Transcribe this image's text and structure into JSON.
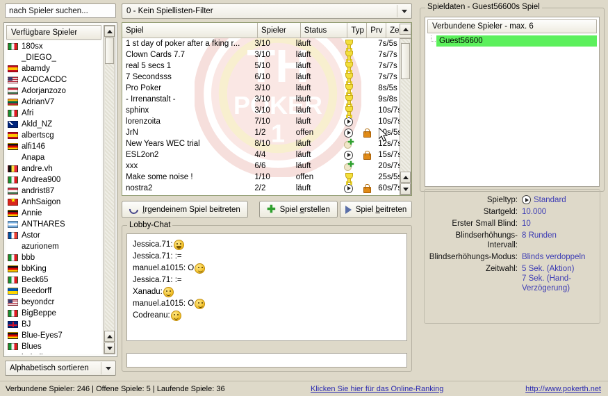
{
  "search": {
    "placeholder": "nach Spieler suchen...",
    "value": "nach Spieler suchen..."
  },
  "filter": {
    "selected": "0 - Kein Spiellisten-Filter"
  },
  "sort": {
    "selected": "Alphabetisch sortieren"
  },
  "players": {
    "header": "Verfügbare Spieler",
    "items": [
      {
        "name": "180sx",
        "flag": "it"
      },
      {
        "name": "_DIEGO_",
        "flag": ""
      },
      {
        "name": "abamdy",
        "flag": "es"
      },
      {
        "name": "ACDCACDC",
        "flag": "us"
      },
      {
        "name": "Adorjanzozo",
        "flag": "hu"
      },
      {
        "name": "AdrianV7",
        "flag": "lt"
      },
      {
        "name": "Afri",
        "flag": "it"
      },
      {
        "name": "Akld_NZ",
        "flag": "nz"
      },
      {
        "name": "albertscg",
        "flag": "es"
      },
      {
        "name": "alfi146",
        "flag": "de"
      },
      {
        "name": "Anapa",
        "flag": ""
      },
      {
        "name": "andre.vh",
        "flag": "be"
      },
      {
        "name": "Andrea900",
        "flag": "it"
      },
      {
        "name": "andrist87",
        "flag": "hu"
      },
      {
        "name": "AnhSaigon",
        "flag": "vn"
      },
      {
        "name": "Annie",
        "flag": "de"
      },
      {
        "name": "ANTHARES",
        "flag": "ar"
      },
      {
        "name": "Astor",
        "flag": "fr"
      },
      {
        "name": "azurionem",
        "flag": ""
      },
      {
        "name": "bbb",
        "flag": "it"
      },
      {
        "name": "bbKing",
        "flag": "de"
      },
      {
        "name": "Beck65",
        "flag": "it"
      },
      {
        "name": "Beedorff",
        "flag": "ua"
      },
      {
        "name": "beyondcr",
        "flag": "us"
      },
      {
        "name": "BigBeppe",
        "flag": "it"
      },
      {
        "name": "BJ",
        "flag": "gb"
      },
      {
        "name": "Blue-Eyes7",
        "flag": "de"
      },
      {
        "name": "Blues",
        "flag": "it"
      },
      {
        "name": "bobalk",
        "flag": "it"
      }
    ]
  },
  "games": {
    "columns": [
      "Spiel",
      "Spieler",
      "Status",
      "Typ",
      "Prv",
      "Zeit"
    ],
    "rows": [
      {
        "name": "1 st day of poker after a fking r...",
        "players": "3/10",
        "status": "läuft",
        "type": "trophy",
        "private": "",
        "time": "7s/5s"
      },
      {
        "name": "Clown Cards 7.7",
        "players": "3/10",
        "status": "läuft",
        "type": "trophy",
        "private": "",
        "time": "7s/7s"
      },
      {
        "name": "real 5 secs 1",
        "players": "5/10",
        "status": "läuft",
        "type": "trophy",
        "private": "",
        "time": "7s/7s"
      },
      {
        "name": "7 Secondsss",
        "players": "6/10",
        "status": "läuft",
        "type": "trophy",
        "private": "",
        "time": "7s/7s"
      },
      {
        "name": "Pro Poker",
        "players": "3/10",
        "status": "läuft",
        "type": "trophy",
        "private": "",
        "time": "8s/5s"
      },
      {
        "name": "- Irrenanstalt -",
        "players": "3/10",
        "status": "läuft",
        "type": "trophy",
        "private": "",
        "time": "9s/8s"
      },
      {
        "name": "sphinx",
        "players": "3/10",
        "status": "läuft",
        "type": "trophy",
        "private": "",
        "time": "10s/7s"
      },
      {
        "name": "lorenzoita",
        "players": "7/10",
        "status": "läuft",
        "type": "standard",
        "private": "",
        "time": "10s/7s"
      },
      {
        "name": "JrN",
        "players": "1/2",
        "status": "offen",
        "type": "standard",
        "private": "lock",
        "time": "10s/5s"
      },
      {
        "name": "New Years WEC trial",
        "players": "8/10",
        "status": "läuft",
        "type": "sng",
        "private": "",
        "time": "12s/7s"
      },
      {
        "name": "ESL2on2",
        "players": "4/4",
        "status": "läuft",
        "type": "standard",
        "private": "lock",
        "time": "15s/7s"
      },
      {
        "name": "xxx",
        "players": "6/6",
        "status": "läuft",
        "type": "sng",
        "private": "",
        "time": "20s/7s"
      },
      {
        "name": "Make some noise !",
        "players": "1/10",
        "status": "offen",
        "type": "trophy",
        "private": "",
        "time": "25s/5s"
      },
      {
        "name": "nostra2",
        "players": "2/2",
        "status": "läuft",
        "type": "standard",
        "private": "lock",
        "time": "60s/7s"
      }
    ]
  },
  "buttons": {
    "join_any": {
      "pre": "",
      "accel": "I",
      "rest": "rgendeinem Spiel beitreten"
    },
    "create": {
      "pre": "Spiel ",
      "accel": "e",
      "rest": "rstellen"
    },
    "join": {
      "pre": "Spiel ",
      "accel": "b",
      "rest": "eitreten"
    }
  },
  "chat": {
    "title": "Lobby-Chat",
    "lines": [
      {
        "text": "Jessica.71: ",
        "smiley": "grin"
      },
      {
        "text": "Jessica.71: :=",
        "smiley": ""
      },
      {
        "text": "manuel.a1015: O",
        "smiley": "smile"
      },
      {
        "text": "Jessica.71: :=",
        "smiley": ""
      },
      {
        "text": "Xanadu: ",
        "smiley": "smile"
      },
      {
        "text": "manuel.a1015: O",
        "smiley": "smile"
      },
      {
        "text": "Codreanu: ",
        "smiley": "smile"
      }
    ],
    "input_value": ""
  },
  "gamedata": {
    "title": "Spieldaten - Guest56600s Spiel",
    "connected_header": "Verbundene Spieler - max. 6",
    "connected_player": "Guest56600",
    "highlight_color": "#5cf05c"
  },
  "properties": [
    {
      "key": "Spieltyp:",
      "value": "Standard",
      "icon": "standard-icon"
    },
    {
      "key": "Startgeld:",
      "value": "10.000",
      "icon": ""
    },
    {
      "key": "Erster Small Blind:",
      "value": "10",
      "icon": ""
    },
    {
      "key": "Blindserhöhungs-Intervall:",
      "value": "8 Runden",
      "icon": ""
    },
    {
      "key": "Blindserhöhungs-Modus:",
      "value": "Blinds verdoppeln",
      "icon": ""
    },
    {
      "key": "Zeitwahl:",
      "value": "5 Sek. (Aktion)",
      "value2": "7 Sek. (Hand-Verzögerung)",
      "icon": ""
    }
  ],
  "statusbar": {
    "text": "Verbundene Spieler: 246 | Offene Spiele: 5 | Laufende Spiele: 36",
    "ranking_link": "Klicken Sie hier für das Online-Ranking",
    "site_link": "http://www.pokerth.net"
  }
}
